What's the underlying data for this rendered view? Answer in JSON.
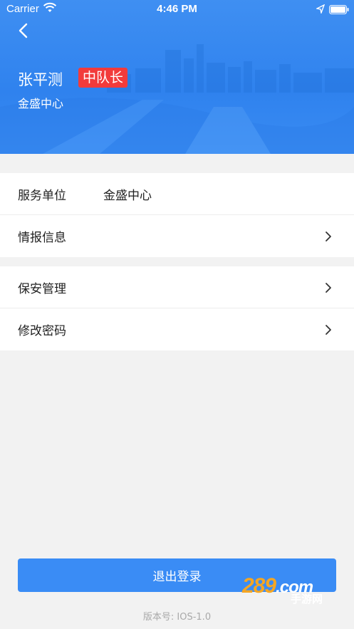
{
  "status_bar": {
    "carrier": "Carrier",
    "time": "4:46 PM"
  },
  "header": {
    "name": "张平测",
    "role_badge": "中队长",
    "organization": "金盛中心",
    "background_color": "#3585f0",
    "badge_color": "#f23b3b"
  },
  "list_group_1": {
    "items": [
      {
        "label": "服务单位",
        "value": "金盛中心",
        "icon": ""
      },
      {
        "label": "情报信息",
        "value": "",
        "icon": "chevron-right-icon"
      }
    ]
  },
  "list_group_2": {
    "items": [
      {
        "label": "保安管理",
        "icon": "chevron-right-icon"
      },
      {
        "label": "修改密码",
        "icon": "chevron-right-icon"
      }
    ]
  },
  "logout_button": {
    "label": "退出登录",
    "color": "#3a8cf5"
  },
  "version": "版本号: IOS-1.0",
  "watermark": {
    "main": "289",
    "domain": ".com",
    "sub": "手游网"
  }
}
